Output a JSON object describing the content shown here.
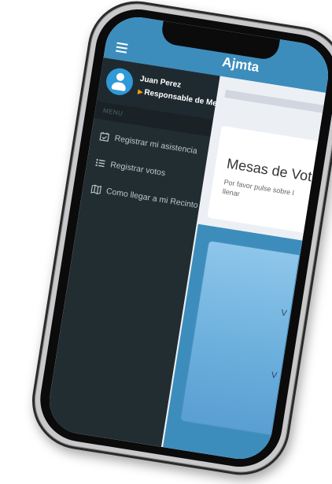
{
  "app": {
    "title": "Ajmta"
  },
  "user": {
    "name": "Juan Perez",
    "role": "Responsable de Mesa"
  },
  "menu": {
    "header": "MENU",
    "items": [
      {
        "label": "Registrar mi asistencia",
        "icon": "calendar-check-icon"
      },
      {
        "label": "Registrar votos",
        "icon": "list-icon"
      },
      {
        "label": "Como llegar a mi Recinto",
        "icon": "map-icon"
      }
    ]
  },
  "content": {
    "box_title": "Mesas de Vot",
    "box_subtitle": "Por favor pulse sobre l llenar",
    "card_label_1": "V",
    "card_label_2": "V"
  },
  "colors": {
    "topbar": "#3c8dbc",
    "sidebar": "#222d32",
    "role_marker": "#f39c12",
    "avatar": "#2e9ad8"
  }
}
